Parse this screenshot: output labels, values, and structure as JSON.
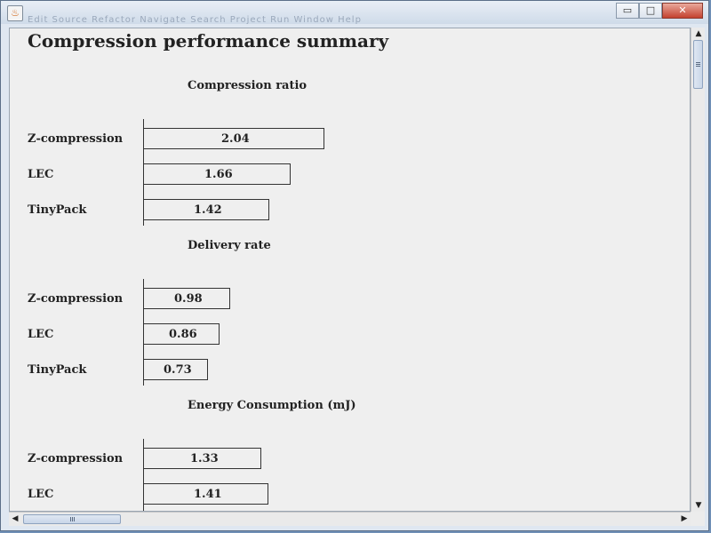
{
  "window": {
    "menu_ghost": "Edit   Source   Refactor   Navigate   Search   Project   Run   Window   Help",
    "minimize_glyph": "▭",
    "maximize_glyph": "□",
    "close_glyph": "✕",
    "app_icon_glyph": "♨"
  },
  "page": {
    "title": "Compression performance summary"
  },
  "scroll": {
    "up": "▲",
    "down": "▼",
    "left": "◀",
    "right": "▶"
  },
  "sections": [
    {
      "title": "Compression ratio",
      "rows": [
        {
          "label": "Z-compression",
          "value": "2.04"
        },
        {
          "label": "LEC",
          "value": "1.66"
        },
        {
          "label": "TinyPack",
          "value": "1.42"
        }
      ]
    },
    {
      "title": "Delivery rate",
      "rows": [
        {
          "label": "Z-compression",
          "value": "0.98"
        },
        {
          "label": "LEC",
          "value": "0.86"
        },
        {
          "label": "TinyPack",
          "value": "0.73"
        }
      ]
    },
    {
      "title": "Energy Consumption (mJ)",
      "rows": [
        {
          "label": "Z-compression",
          "value": "1.33"
        },
        {
          "label": "LEC",
          "value": "1.41"
        }
      ]
    }
  ],
  "chart_data": [
    {
      "type": "bar",
      "title": "Compression ratio",
      "categories": [
        "Z-compression",
        "LEC",
        "TinyPack"
      ],
      "values": [
        2.04,
        1.66,
        1.42
      ],
      "xlabel": "",
      "ylabel": ""
    },
    {
      "type": "bar",
      "title": "Delivery rate",
      "categories": [
        "Z-compression",
        "LEC",
        "TinyPack"
      ],
      "values": [
        0.98,
        0.86,
        0.73
      ],
      "xlabel": "",
      "ylabel": ""
    },
    {
      "type": "bar",
      "title": "Energy Consumption (mJ)",
      "categories": [
        "Z-compression",
        "LEC"
      ],
      "values": [
        1.33,
        1.41
      ],
      "xlabel": "",
      "ylabel": ""
    }
  ]
}
